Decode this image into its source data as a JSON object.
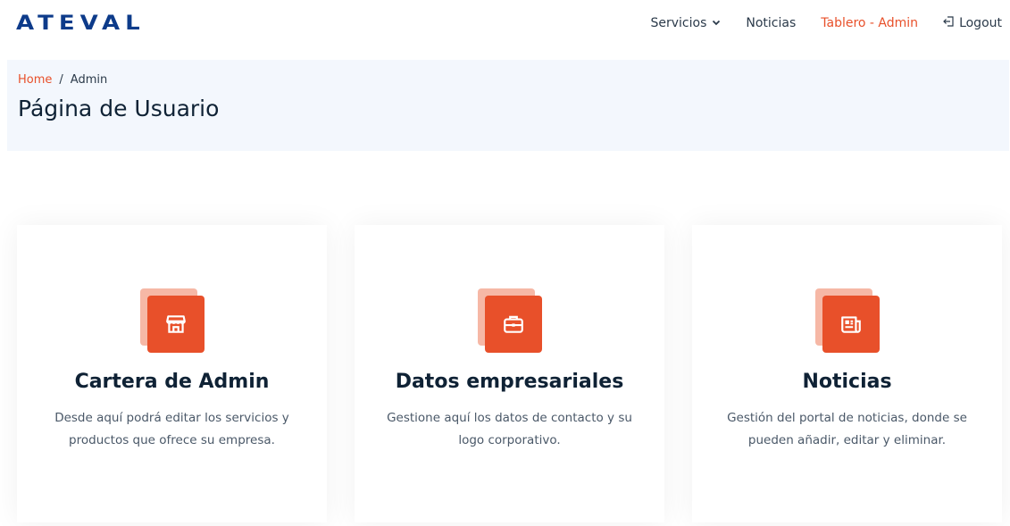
{
  "header": {
    "logo": "ATEVAL",
    "nav": {
      "servicios": "Servicios",
      "noticias": "Noticias",
      "tablero": "Tablero - Admin",
      "logout": "Logout"
    }
  },
  "breadcrumb": {
    "home": "Home",
    "separator": "/",
    "current": "Admin"
  },
  "page": {
    "title": "Página de Usuario"
  },
  "cards": [
    {
      "icon": "storefront-icon",
      "title": "Cartera de Admin",
      "description": "Desde aquí podrá editar los servicios y productos que ofrece su empresa."
    },
    {
      "icon": "briefcase-icon",
      "title": "Datos empresariales",
      "description": "Gestione aquí los datos de contacto y su logo corporativo."
    },
    {
      "icon": "newspaper-icon",
      "title": "Noticias",
      "description": "Gestión del portal de noticias, donde se pueden añadir, editar y eliminar."
    }
  ],
  "colors": {
    "accent": "#e8502a",
    "accent_light": "#f6b8a6",
    "brand": "#0d3b8a",
    "banner_bg": "#f3f7fd"
  }
}
